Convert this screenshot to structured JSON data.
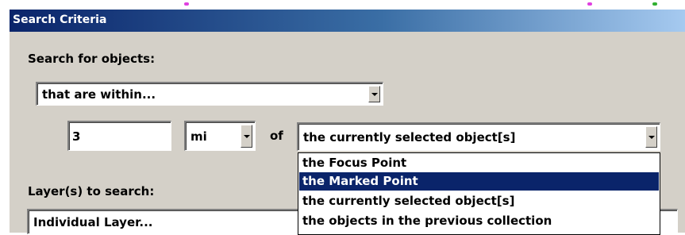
{
  "window": {
    "title": "Search Criteria"
  },
  "search_for": {
    "label": "Search for objects:",
    "mode": "that are within..."
  },
  "distance": {
    "value": "3",
    "unit": "mi",
    "of_label": "of",
    "reference": "the currently selected object[s]"
  },
  "reference_options": [
    {
      "label": "the Focus Point",
      "selected": false
    },
    {
      "label": "the Marked Point",
      "selected": true
    },
    {
      "label": "the currently selected object[s]",
      "selected": false
    },
    {
      "label": "the objects in the previous collection",
      "selected": false
    }
  ],
  "layers": {
    "label": "Layer(s) to search:",
    "value": "Individual Layer..."
  },
  "colors": {
    "title_start": "#0a246a",
    "title_end": "#a6caf0",
    "dialog_bg": "#d4d0c8",
    "selection_bg": "#0a246a"
  }
}
